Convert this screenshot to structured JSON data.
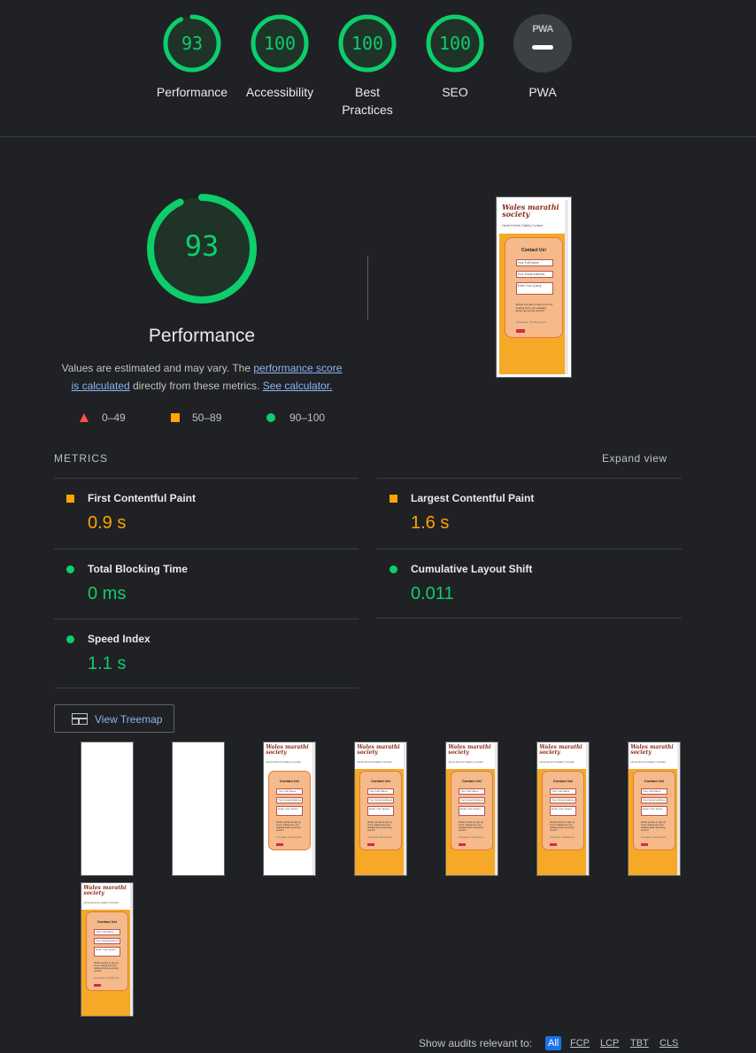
{
  "categories": [
    {
      "label": "Performance",
      "score": "93"
    },
    {
      "label": "Accessibility",
      "score": "100"
    },
    {
      "label": "Best Practices",
      "line1": "Best",
      "line2": "Practices",
      "score": "100"
    },
    {
      "label": "SEO",
      "score": "100"
    },
    {
      "label": "PWA",
      "badge": "PWA"
    }
  ],
  "main": {
    "score": "93",
    "title": "Performance",
    "desc_part1": "Values are estimated and may vary. The ",
    "desc_link1": "performance score is calculated",
    "desc_link1_a": "performance score",
    "desc_link1_b": "is calculated",
    "desc_part2": " directly from these metrics. ",
    "desc_link2": "See calculator."
  },
  "legend": {
    "fail": "0–49",
    "average": "50–89",
    "pass": "90–100"
  },
  "metrics": {
    "heading": "METRICS",
    "expand_label": "Expand view",
    "items": [
      {
        "title": "First Contentful Paint",
        "value": "0.9 s",
        "status": "average"
      },
      {
        "title": "Largest Contentful Paint",
        "value": "1.6 s",
        "status": "average"
      },
      {
        "title": "Total Blocking Time",
        "value": "0 ms",
        "status": "pass"
      },
      {
        "title": "Cumulative Layout Shift",
        "value": "0.011",
        "status": "pass"
      },
      {
        "title": "Speed Index",
        "value": "1.1 s",
        "status": "pass"
      }
    ]
  },
  "treemap_label": "View Treemap",
  "phone": {
    "brand_line1": "Wales marathi",
    "brand_line2": "society",
    "nav": "Home  Events  Gallery  Contact",
    "form_title": "Contact Us!",
    "input_name": "Your Full Name",
    "input_email": "Your Email Address",
    "input_query": "Enter Your Query",
    "mailing_text": "Would you like to sign up to our mailing list to our updated about upcoming events?",
    "choice_yes": "Yes please",
    "choice_no": "No thank you"
  },
  "audits": {
    "label": "Show audits relevant to:",
    "filters": [
      "All",
      "FCP",
      "LCP",
      "TBT",
      "CLS"
    ],
    "active": "All"
  },
  "colors": {
    "pass": "#0cce6b",
    "average": "#ffa400",
    "fail": "#ff4e42",
    "link": "#8ab4f8",
    "background": "#202124"
  }
}
